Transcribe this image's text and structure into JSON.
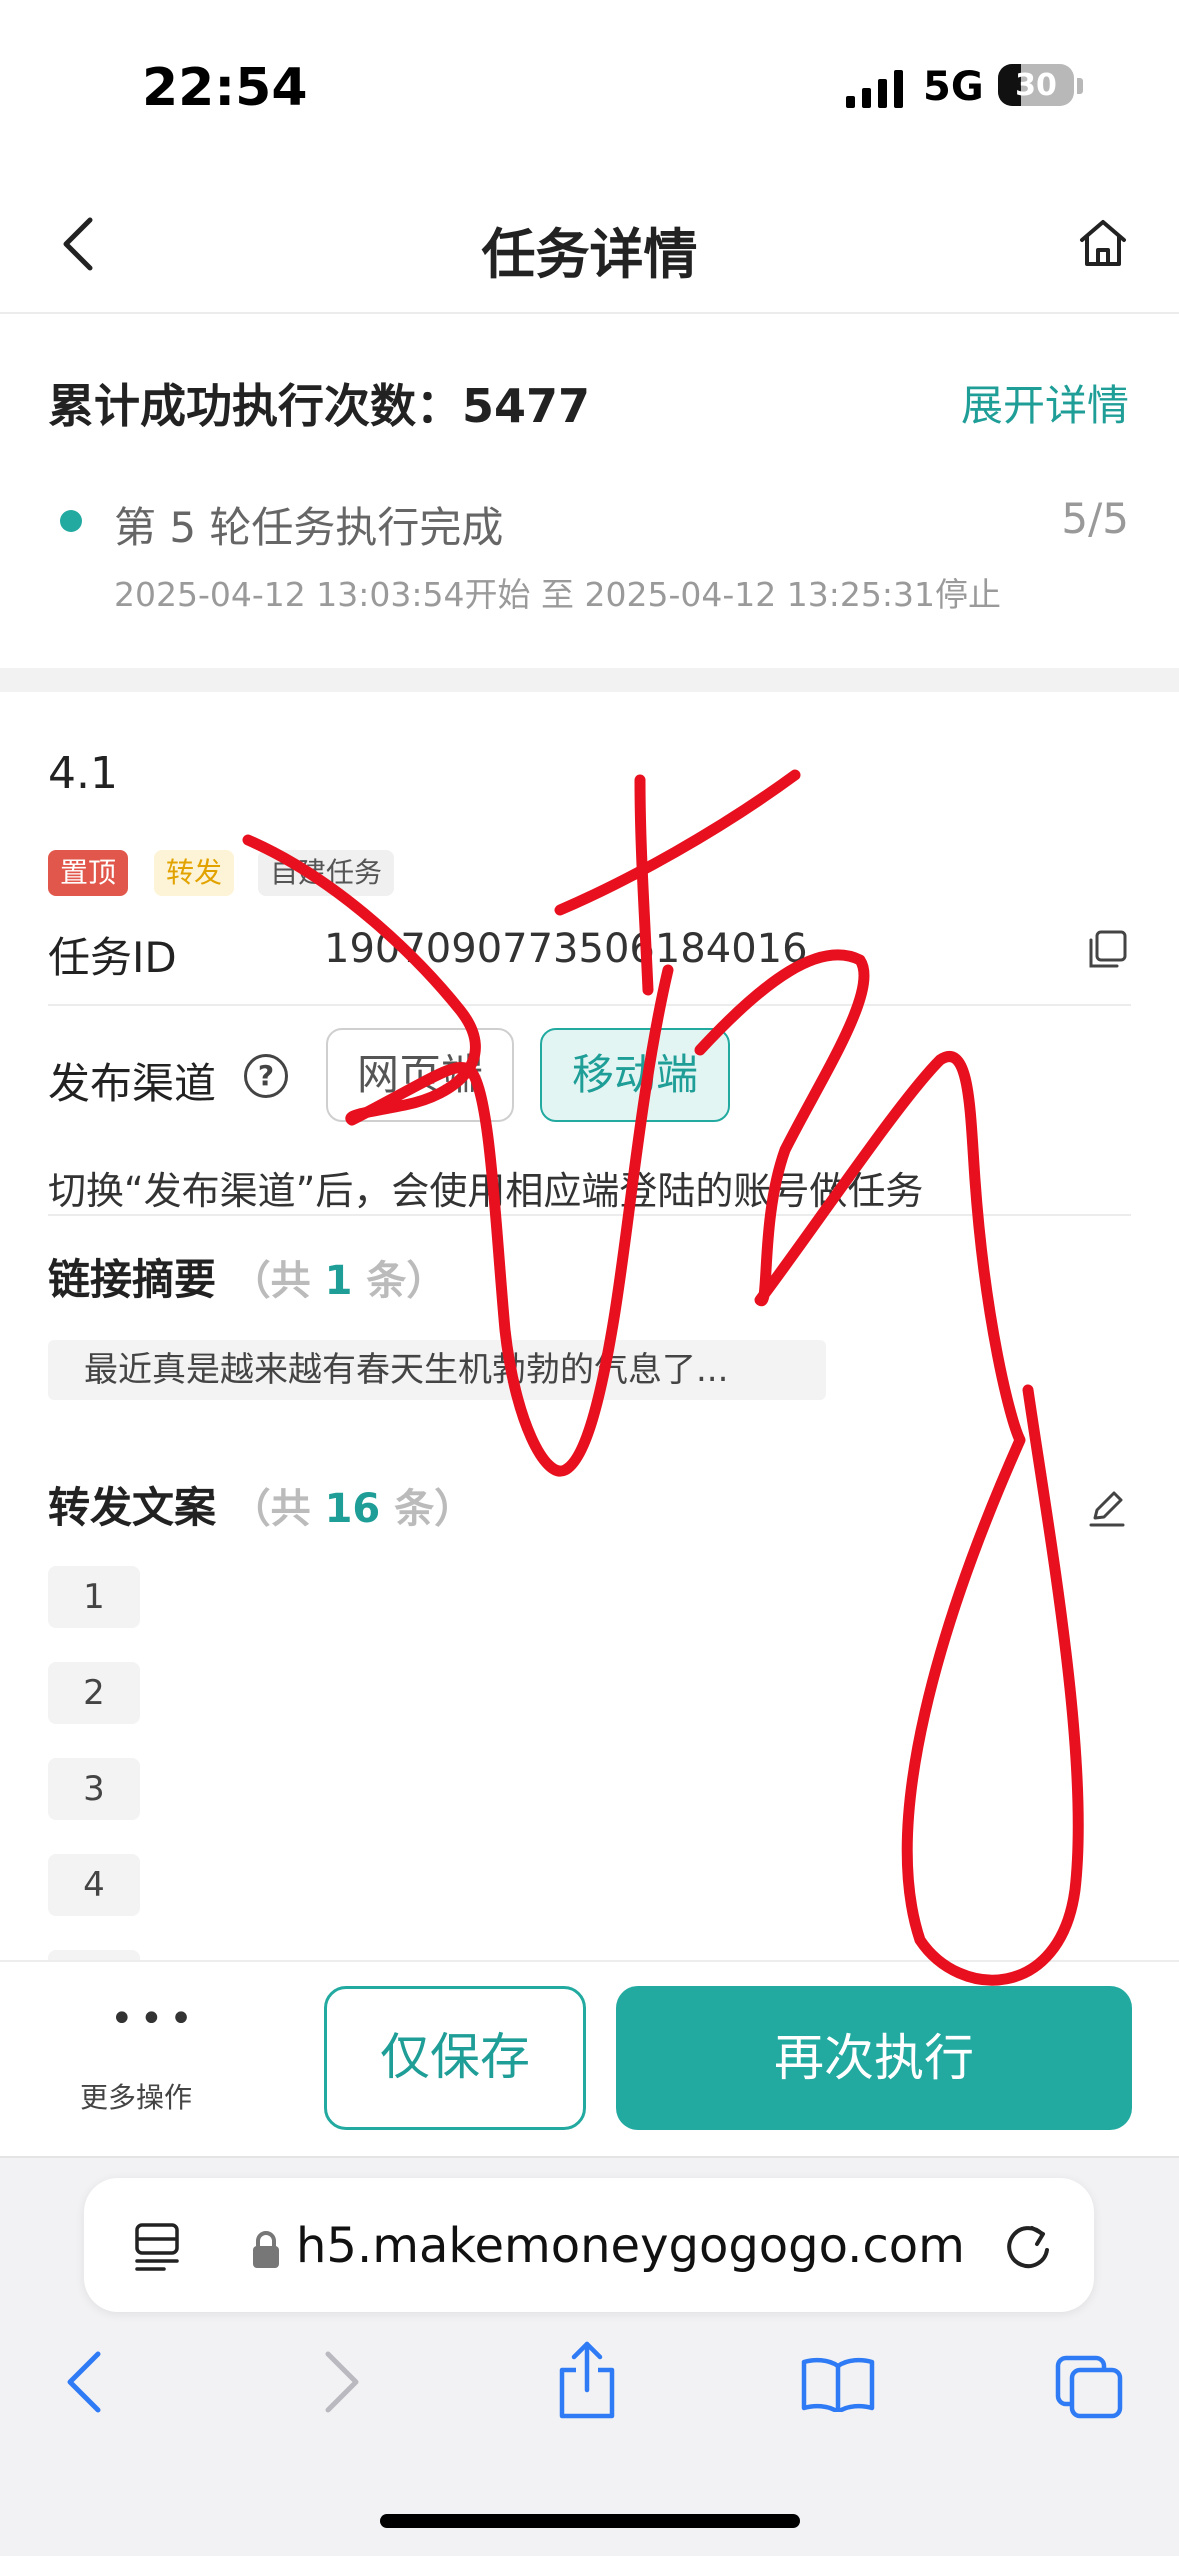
{
  "status_bar": {
    "time": "22:54",
    "network": "5G",
    "battery": "30"
  },
  "header": {
    "title": "任务详情"
  },
  "summary": {
    "label": "累计成功执行次数：5477",
    "expand_link": "展开详情",
    "round_text": "第 5 轮任务执行完成",
    "round_count": "5/5",
    "round_time": "2025-04-12 13:03:54开始 至 2025-04-12 13:25:31停止"
  },
  "task": {
    "name": "4.1",
    "tags": [
      "置顶",
      "转发",
      "自建任务"
    ],
    "id_label": "任务ID",
    "id_value": "1907090773506184016",
    "channel_label": "发布渠道",
    "channel_options": [
      "网页端",
      "移动端"
    ],
    "channel_selected": "移动端",
    "channel_note": "切换“发布渠道”后，会使用相应端登陆的账号做任务",
    "link_summary": {
      "title": "链接摘要",
      "count_prefix": "（共",
      "count": "1",
      "count_suffix": "条）",
      "item": "最近真是越来越有春天生机勃勃的气息了..."
    },
    "copy_text": {
      "title": "转发文案",
      "count_prefix": "（共",
      "count": "16",
      "count_suffix": "条）",
      "items": [
        "1",
        "2",
        "3",
        "4"
      ]
    }
  },
  "actions": {
    "more_label": "更多操作",
    "save_label": "仅保存",
    "run_label": "再次执行"
  },
  "browser": {
    "url": "h5.makemoneygogogo.com"
  },
  "colors": {
    "accent": "#22aaa1",
    "tag_red": "#e2574b",
    "tag_yellow": "#e2a300",
    "scribble": "#e8101e"
  },
  "icons": [
    "back-icon",
    "home-icon",
    "copy-icon",
    "help-icon",
    "edit-icon",
    "more-icon",
    "reader-icon",
    "lock-icon",
    "reload-icon",
    "browser-back-icon",
    "browser-forward-icon",
    "share-icon",
    "bookmarks-icon",
    "tabs-icon"
  ]
}
